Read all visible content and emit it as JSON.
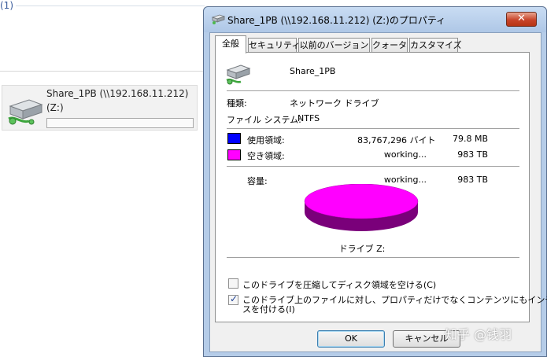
{
  "background": {
    "group_count": "(1)",
    "tile": {
      "name": "Share_1PB (\\\\192.168.11.212)",
      "letter": "(Z:)"
    }
  },
  "dialog": {
    "title": "Share_1PB (\\\\192.168.11.212) (Z:)のプロパティ",
    "close_label": "✕",
    "tabs": [
      {
        "label": "全般",
        "active": true
      },
      {
        "label": "セキュリティ"
      },
      {
        "label": "以前のバージョン"
      },
      {
        "label": "クォータ"
      },
      {
        "label": "カスタマイズ"
      }
    ],
    "drive_name": "Share_1PB",
    "type_label": "種類:",
    "type_value": "ネットワーク ドライブ",
    "fs_label": "ファイル システム:",
    "fs_value": "NTFS",
    "used": {
      "label": "使用領域:",
      "bytes": "83,767,296 バイト",
      "size": "79.8 MB",
      "color": "#0000ff"
    },
    "free": {
      "label": "空き領域:",
      "bytes": "working...",
      "size": "983 TB",
      "color": "#ff00ff"
    },
    "capacity": {
      "label": "容量:",
      "bytes": "working...",
      "size": "983 TB"
    },
    "pie_caption": "ドライブ Z:",
    "compress": {
      "label": "このドライブを圧縮してディスク領域を空ける(C)",
      "checked": false
    },
    "index": {
      "label_line1": "このドライブ上のファイルに対し、プロパティだけでなくコンテンツにもインデック",
      "label_line2": "スを付ける(I)",
      "checked": true
    },
    "buttons": {
      "ok": "OK",
      "cancel": "キャンセル"
    }
  },
  "watermark": "知乎 @钱羽"
}
